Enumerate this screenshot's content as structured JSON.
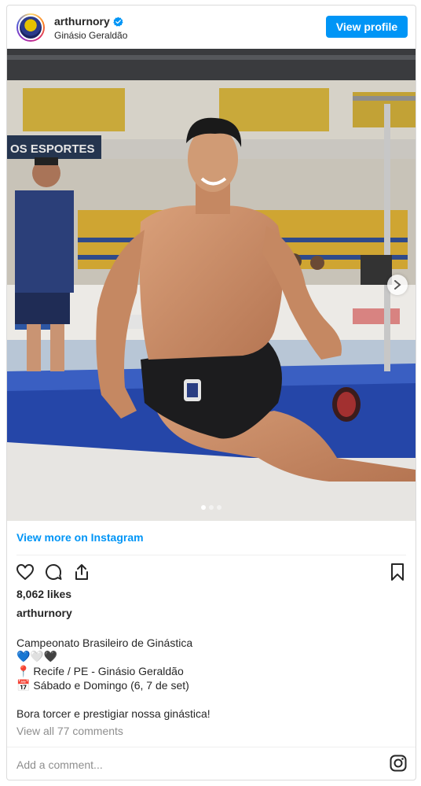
{
  "header": {
    "username": "arthurnory",
    "location": "Ginásio Geraldão",
    "view_profile_label": "View profile"
  },
  "photo": {
    "alt": "Gymnast sitting on the edge of a blue mat in an arena",
    "banner_text": "OS ESPORTES",
    "carousel": {
      "count": 3,
      "active": 1
    }
  },
  "view_more_label": "View more on Instagram",
  "likes": "8,062 likes",
  "author": "arthurnory",
  "caption": {
    "line1": "Campeonato Brasileiro de Ginástica",
    "hearts": "💙🤍🖤",
    "line3_emoji": "📍",
    "line3": "Recife / PE - Ginásio Geraldão",
    "line4_emoji": "📅",
    "line4": "Sábado e Domingo (6, 7 de set)",
    "line5": "Bora torcer e prestigiar nossa ginástica!"
  },
  "view_comments": "View all 77 comments",
  "add_comment_placeholder": "Add a comment...",
  "icons": {
    "like": "heart-icon",
    "comment": "comment-icon",
    "share": "share-icon",
    "save": "bookmark-icon",
    "instagram": "instagram-icon",
    "verified": "verified-badge-icon"
  },
  "colors": {
    "accent": "#0095f6",
    "text": "#262626",
    "muted": "#8e8e8e",
    "border": "#dbdbdb"
  }
}
